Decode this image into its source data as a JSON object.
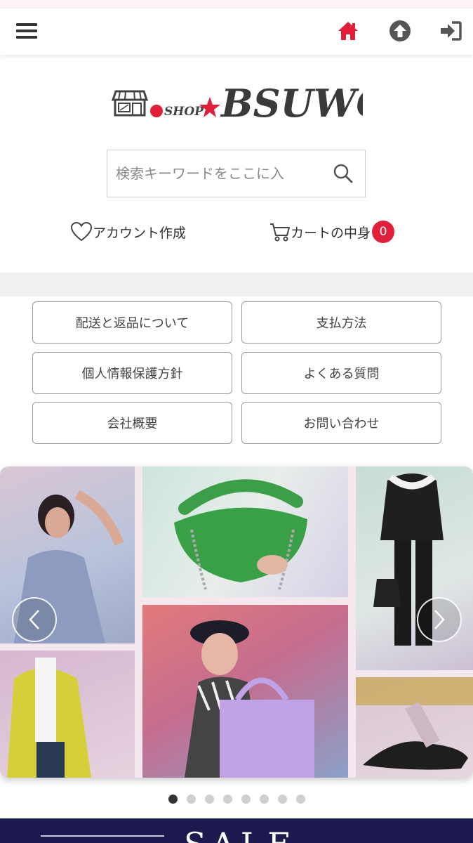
{
  "navbar": {
    "menu_icon": "hamburger-icon",
    "home_icon": "home-icon",
    "upload_icon": "arrow-up-circle-icon",
    "login_icon": "sign-in-icon",
    "home_color": "#e0203a"
  },
  "logo": {
    "shop_text": "SHOP",
    "brand_text": "BSUWG"
  },
  "search": {
    "placeholder": "検索キーワードをここに入",
    "value": ""
  },
  "account": {
    "create_label": "アカウント作成",
    "cart_label": "カートの中身",
    "cart_count": "0"
  },
  "info_buttons": [
    "配送と返品について",
    "支払方法",
    "個人情報保護方針",
    "よくある質問",
    "会社概要",
    "お問い合わせ"
  ],
  "carousel": {
    "slide_count": 8,
    "active_index": 0
  },
  "banner": {
    "text": "SALE"
  },
  "colors": {
    "accent": "#e0203a",
    "banner_bg": "#1c1a4e"
  }
}
